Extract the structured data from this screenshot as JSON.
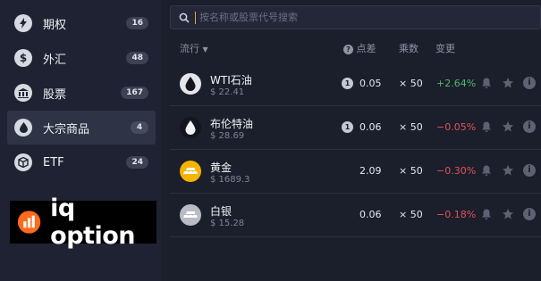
{
  "sidebar": {
    "items": [
      {
        "label": "期权",
        "count": "16",
        "icon": "lightning-icon"
      },
      {
        "label": "外汇",
        "count": "48",
        "icon": "dollar-icon"
      },
      {
        "label": "股票",
        "count": "167",
        "icon": "bank-icon"
      },
      {
        "label": "大宗商品",
        "count": "4",
        "icon": "drop-icon",
        "active": true
      },
      {
        "label": "ETF",
        "count": "24",
        "icon": "cube-icon"
      }
    ]
  },
  "logo": {
    "text": "iq option",
    "color": "#ff6a1b"
  },
  "search": {
    "placeholder": "按名称或股票代号搜索"
  },
  "table": {
    "headers": {
      "sort": "流行",
      "spread": "点差",
      "multiplier": "乘数",
      "change": "变更"
    },
    "rows": [
      {
        "name": "WTI石油",
        "price": "$ 22.41",
        "badge": "1",
        "spread": "0.05",
        "multiplier": "× 50",
        "change": "+2.64%",
        "dir": "up",
        "icon": "oil-drop-icon"
      },
      {
        "name": "布伦特油",
        "price": "$ 28.69",
        "badge": "1",
        "spread": "0.06",
        "multiplier": "× 50",
        "change": "−0.05%",
        "dir": "down",
        "icon": "oil-drop-icon"
      },
      {
        "name": "黄金",
        "price": "$ 1689.3",
        "badge": "",
        "spread": "2.09",
        "multiplier": "× 50",
        "change": "−0.30%",
        "dir": "down",
        "icon": "gold-bars-icon"
      },
      {
        "name": "白银",
        "price": "$ 15.28",
        "badge": "",
        "spread": "0.06",
        "multiplier": "× 50",
        "change": "−0.18%",
        "dir": "down",
        "icon": "silver-bars-icon"
      }
    ]
  },
  "colors": {
    "up": "#4dbb6b",
    "down": "#e2525b",
    "gold": "#f4b400",
    "silver": "#b9bcc4"
  }
}
